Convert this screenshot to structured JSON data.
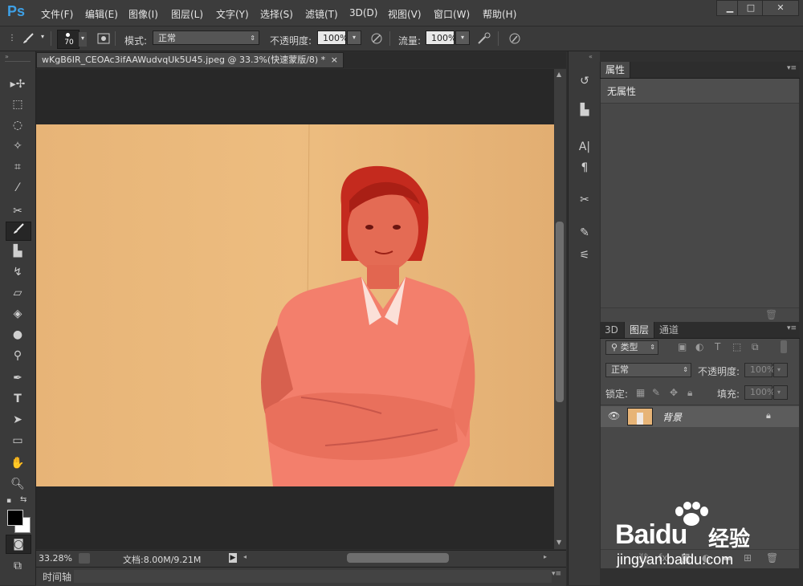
{
  "app": {
    "logo": "Ps"
  },
  "menu": [
    "文件(F)",
    "编辑(E)",
    "图像(I)",
    "图层(L)",
    "文字(Y)",
    "选择(S)",
    "滤镜(T)",
    "3D(D)",
    "视图(V)",
    "窗口(W)",
    "帮助(H)"
  ],
  "window_controls": {
    "minimize": "▁",
    "maximize": "□",
    "close": "✕"
  },
  "options": {
    "brush_size": "70",
    "mode_label": "模式:",
    "mode_value": "正常",
    "opacity_label": "不透明度:",
    "opacity_value": "100%",
    "flow_label": "流量:",
    "flow_value": "100%"
  },
  "document": {
    "tab_title": "wKgB6IR_CEOAc3ifAAWudvqUk5U45.jpeg @ 33.3%(快速蒙版/8) *",
    "tab_close": "×",
    "zoom": "33.28%",
    "doc_info": "文档:8.00M/9.21M"
  },
  "timeline": {
    "label": "时间轴"
  },
  "properties": {
    "tab": "属性",
    "content": "无属性"
  },
  "layers_panel": {
    "tabs": [
      "3D",
      "图层",
      "通道"
    ],
    "filter_label": "类型",
    "blend_mode": "正常",
    "opacity_label": "不透明度:",
    "opacity_value": "100%",
    "lock_label": "锁定:",
    "fill_label": "填充:",
    "fill_value": "100%",
    "layer_name": "背景"
  },
  "watermark": {
    "brand": "Baidu",
    "brand_cn": "经验",
    "url": "jingyan.baidu.com"
  },
  "colors": {
    "accent": "#3ea0e6",
    "mask_overlay": "#ff5a4a",
    "photo_bg": "#e9b978"
  }
}
